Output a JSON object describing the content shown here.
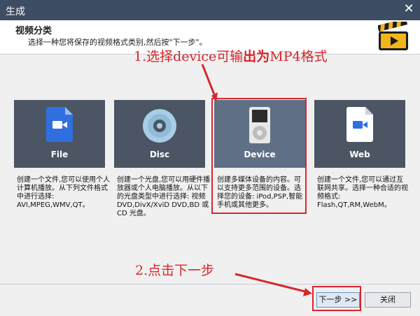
{
  "window": {
    "title": "生成",
    "close_glyph": "✕"
  },
  "header": {
    "title": "视频分类",
    "subtitle": "选择一种您将保存的视频格式类别,然后按\"下一步\"。"
  },
  "annotations": {
    "step1_prefix": "1.选择device可输",
    "step1_bold": "出为",
    "step1_suffix": "MP4格式",
    "step2": "2.点击下一步"
  },
  "cards": [
    {
      "label": "File",
      "icon": "file-video-icon",
      "description": "创建一个文件,您可以使用个人计算机播放。从下列文件格式中进行选择: AVI,MPEG,WMV,QT。"
    },
    {
      "label": "Disc",
      "icon": "disc-icon",
      "description": "创建一个光盘,您可以用硬件播放器或个人电脑播放。从以下的光盘类型中进行选择: 视频 DVD,DivX/XviD DVD,BD 或 CD 光盘。"
    },
    {
      "label": "Device",
      "icon": "ipod-icon",
      "description": "创建多媒体设备的内容。可以支持更多范围的设备。选择您的设备: iPod,PSP,智能手机或其他更多。"
    },
    {
      "label": "Web",
      "icon": "web-video-icon",
      "description": "创建一个文件,您可以通过互联网共享。选择一种合适的视频格式: Flash,QT,RM,WebM。"
    }
  ],
  "buttons": {
    "next": "下一步 >>",
    "close": "关闭"
  },
  "colors": {
    "accent_red": "#d8262b",
    "card": "#4b5564",
    "card_selected": "#5f6f86",
    "titlebar": "#3d4d63"
  }
}
